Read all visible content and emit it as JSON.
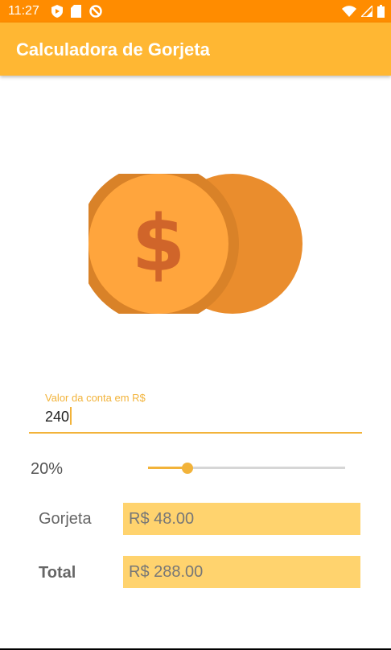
{
  "status_bar": {
    "time": "11:27",
    "left_icons": [
      "shield-icon",
      "sd-card-icon",
      "do-not-disturb-icon"
    ],
    "right_icons": [
      "wifi-icon",
      "signal-icon",
      "battery-icon"
    ]
  },
  "app_bar": {
    "title": "Calculadora de Gorjeta"
  },
  "bill_field": {
    "label": "Valor da conta em R$",
    "value": "240"
  },
  "tip": {
    "percent_label": "20%",
    "slider_level": 0.2
  },
  "results": {
    "tip_label": "Gorjeta",
    "tip_value": "R$ 48.00",
    "total_label": "Total",
    "total_value": "R$ 288.00"
  },
  "colors": {
    "status_bar": "#ff8c00",
    "app_bar": "#ffb733",
    "accent": "#f2b33a",
    "result_box": "#ffd36e",
    "coin_front": "#ffa53d",
    "coin_back": "#ea8d2d",
    "dollar_sign": "#d0652a"
  }
}
